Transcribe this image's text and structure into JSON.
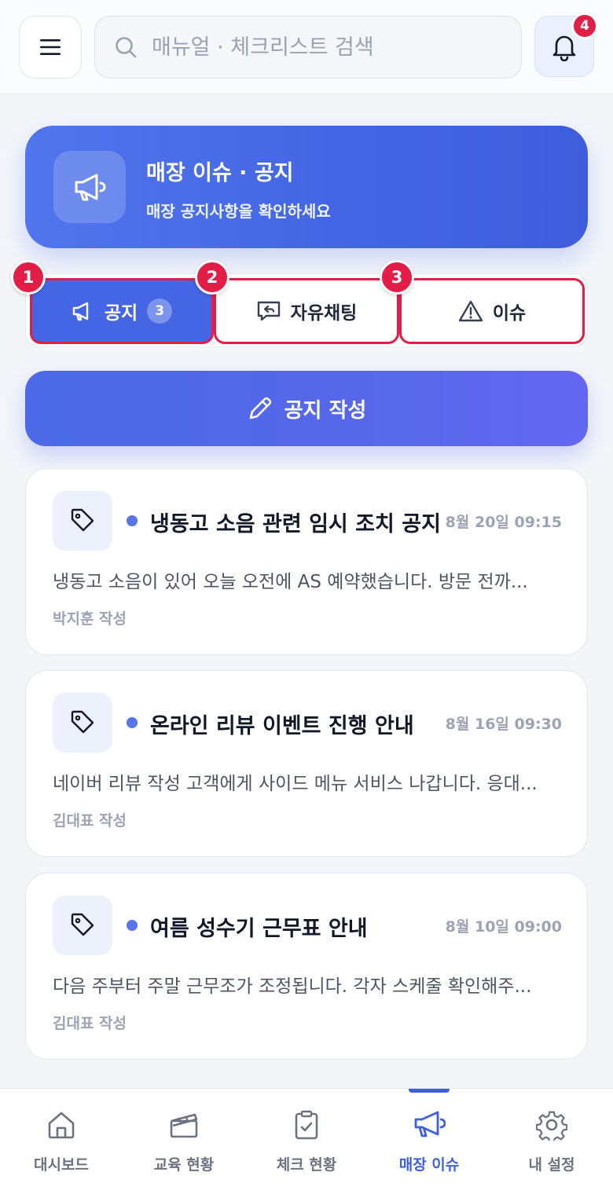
{
  "header": {
    "search_placeholder": "매뉴얼 · 체크리스트 검색",
    "notification_count": "4"
  },
  "hero": {
    "title": "매장 이슈 · 공지",
    "subtitle": "매장 공지사항을 확인하세요"
  },
  "tabs": [
    {
      "label": "공지",
      "count": "3",
      "step": "1",
      "active": true
    },
    {
      "label": "자유채팅",
      "step": "2",
      "active": false
    },
    {
      "label": "이슈",
      "step": "3",
      "active": false
    }
  ],
  "write_button": {
    "label": "공지 작성"
  },
  "notices": [
    {
      "title": "냉동고 소음 관련 임시 조치 공지",
      "date": "8월 20일 09:15",
      "body": "냉동고 소음이 있어 오늘 오전에 AS 예약했습니다. 방문 전까...",
      "author": "박지훈 작성"
    },
    {
      "title": "온라인 리뷰 이벤트 진행 안내",
      "date": "8월 16일 09:30",
      "body": "네이버 리뷰 작성 고객에게 사이드 메뉴 서비스 나갑니다. 응대...",
      "author": "김대표 작성"
    },
    {
      "title": "여름 성수기 근무표 안내",
      "date": "8월 10일 09:00",
      "body": "다음 주부터 주말 근무조가 조정됩니다. 각자 스케줄 확인해주...",
      "author": "김대표 작성"
    }
  ],
  "bottom_nav": [
    {
      "label": "대시보드",
      "icon": "home-icon"
    },
    {
      "label": "교육 현황",
      "icon": "clapperboard-icon"
    },
    {
      "label": "체크 현황",
      "icon": "clipboard-check-icon"
    },
    {
      "label": "매장 이슈",
      "icon": "megaphone-icon",
      "active": true
    },
    {
      "label": "내 설정",
      "icon": "gear-icon"
    }
  ],
  "colors": {
    "accent": "#4466e4",
    "badge_red": "#e11d48",
    "nav_active": "#3e5fdc"
  }
}
